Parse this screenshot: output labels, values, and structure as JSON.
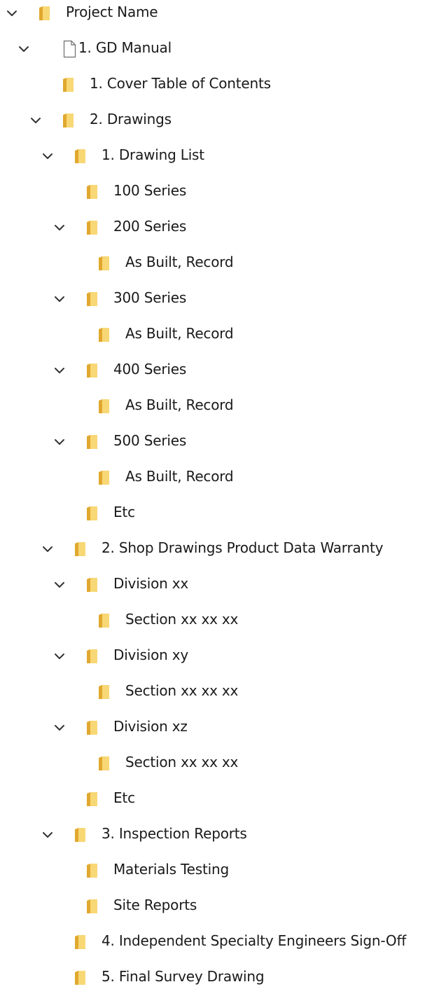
{
  "tree": {
    "nodes": [
      {
        "label": "Project Name",
        "depth": 0,
        "expanded": true,
        "icon": "folder-icon"
      },
      {
        "label": "1. GD Manual",
        "depth": 1,
        "expanded": true,
        "icon": "document-icon"
      },
      {
        "label": "1. Cover Table of Contents",
        "depth": 2,
        "expanded": false,
        "icon": "folder-icon"
      },
      {
        "label": "2. Drawings",
        "depth": 2,
        "expanded": true,
        "icon": "folder-icon"
      },
      {
        "label": "1. Drawing List",
        "depth": 3,
        "expanded": true,
        "icon": "folder-icon"
      },
      {
        "label": "100 Series",
        "depth": 4,
        "expanded": false,
        "icon": "folder-icon"
      },
      {
        "label": "200 Series",
        "depth": 4,
        "expanded": true,
        "icon": "folder-icon"
      },
      {
        "label": "As Built, Record",
        "depth": 5,
        "expanded": false,
        "icon": "folder-icon"
      },
      {
        "label": "300 Series",
        "depth": 4,
        "expanded": true,
        "icon": "folder-icon"
      },
      {
        "label": "As Built, Record",
        "depth": 5,
        "expanded": false,
        "icon": "folder-icon"
      },
      {
        "label": "400 Series",
        "depth": 4,
        "expanded": true,
        "icon": "folder-icon"
      },
      {
        "label": "As Built, Record",
        "depth": 5,
        "expanded": false,
        "icon": "folder-icon"
      },
      {
        "label": "500 Series",
        "depth": 4,
        "expanded": true,
        "icon": "folder-icon"
      },
      {
        "label": "As Built, Record",
        "depth": 5,
        "expanded": false,
        "icon": "folder-icon"
      },
      {
        "label": "Etc",
        "depth": 4,
        "expanded": false,
        "icon": "folder-icon"
      },
      {
        "label": "2. Shop Drawings Product Data Warranty",
        "depth": 3,
        "expanded": true,
        "icon": "folder-icon"
      },
      {
        "label": "Division xx",
        "depth": 4,
        "expanded": true,
        "icon": "folder-icon"
      },
      {
        "label": "Section xx xx xx",
        "depth": 5,
        "expanded": false,
        "icon": "folder-icon"
      },
      {
        "label": "Division xy",
        "depth": 4,
        "expanded": true,
        "icon": "folder-icon"
      },
      {
        "label": "Section xx xx xx",
        "depth": 5,
        "expanded": false,
        "icon": "folder-icon"
      },
      {
        "label": "Division xz",
        "depth": 4,
        "expanded": true,
        "icon": "folder-icon"
      },
      {
        "label": "Section xx xx xx",
        "depth": 5,
        "expanded": false,
        "icon": "folder-icon"
      },
      {
        "label": "Etc",
        "depth": 4,
        "expanded": false,
        "icon": "folder-icon"
      },
      {
        "label": "3. Inspection Reports",
        "depth": 3,
        "expanded": true,
        "icon": "folder-icon"
      },
      {
        "label": "Materials Testing",
        "depth": 4,
        "expanded": false,
        "icon": "folder-icon"
      },
      {
        "label": "Site Reports",
        "depth": 4,
        "expanded": false,
        "icon": "folder-icon"
      },
      {
        "label": "4. Independent Specialty Engineers Sign-Off",
        "depth": 3,
        "expanded": false,
        "icon": "folder-icon"
      },
      {
        "label": "5. Final Survey Drawing",
        "depth": 3,
        "expanded": false,
        "icon": "folder-icon"
      }
    ]
  },
  "colors": {
    "folder_light": "#f8d775",
    "folder_dark": "#e0a82e",
    "chevron": "#333333",
    "text": "#1a1a1a",
    "doc_stroke": "#6d6d6d"
  }
}
